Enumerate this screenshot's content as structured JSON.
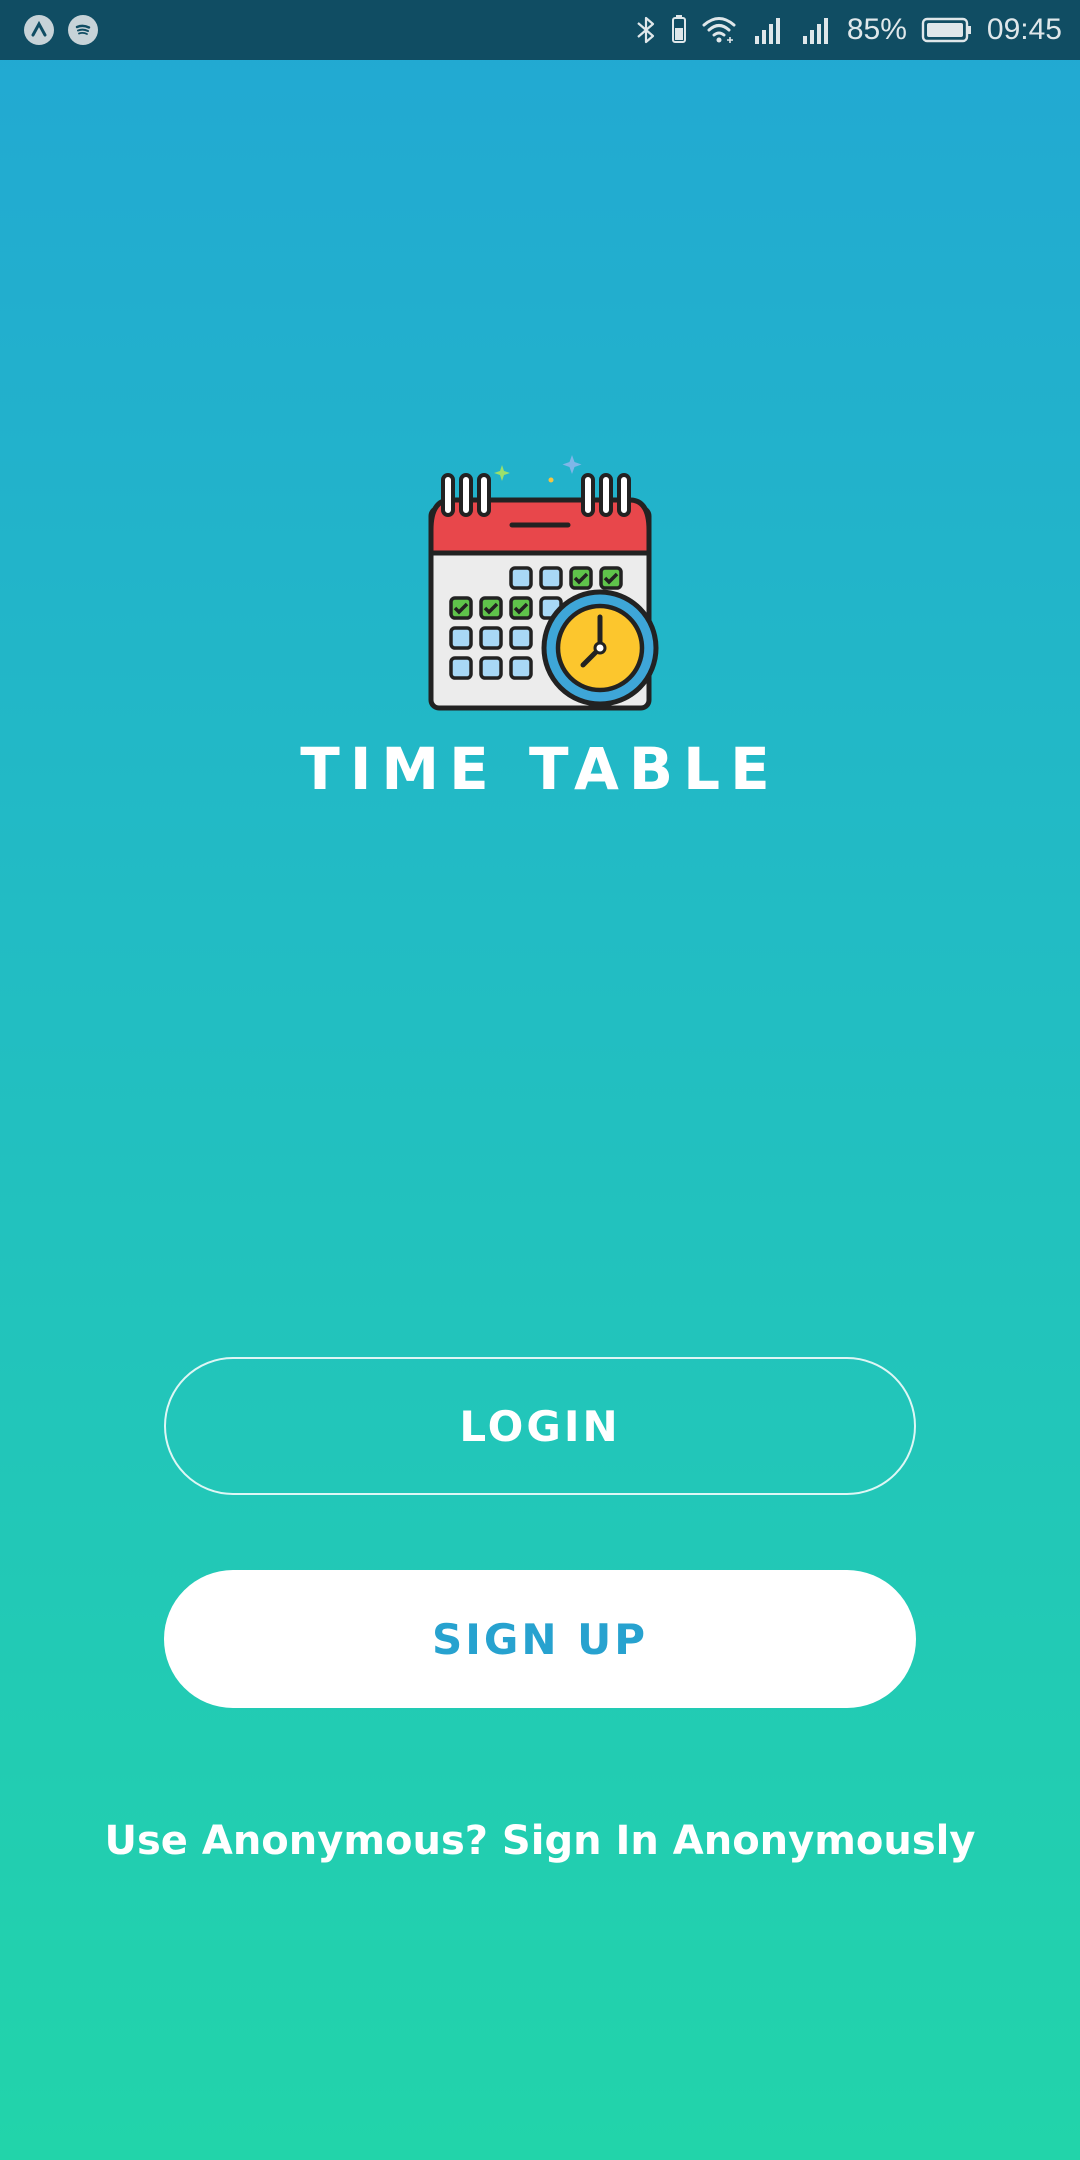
{
  "status_bar": {
    "left_icons": [
      "app-a-icon",
      "spotify-icon"
    ],
    "right_icons": [
      "bluetooth-icon",
      "vibrate-battery-icon",
      "wifi-icon",
      "signal-icon",
      "signal-icon",
      "battery-icon"
    ],
    "battery_percent": "85%",
    "time": "09:45"
  },
  "app": {
    "logo_icon": "calendar-clock-icon",
    "title": "TIME TABLE"
  },
  "actions": {
    "login_label": "LOGIN",
    "signup_label": "SIGN UP",
    "anonymous_prompt": "Use Anonymous?",
    "anonymous_link": "Sign In Anonymously"
  },
  "colors": {
    "status_bar": "#104d63",
    "gradient_top": "#22a8d3",
    "gradient_bottom": "#22d4aa",
    "signup_text": "#27a2cf",
    "calendar_red": "#e8474b",
    "clock_yellow": "#fcc62d",
    "check_green": "#5fc44b"
  }
}
